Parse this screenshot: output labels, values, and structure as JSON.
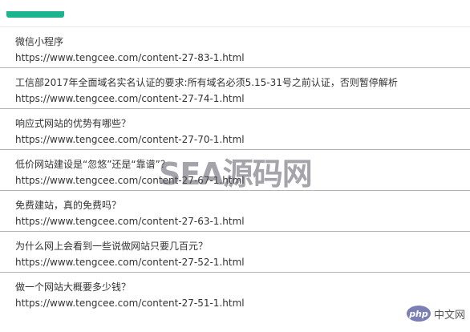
{
  "articles": [
    {
      "title": "微信小程序",
      "url": "https://www.tengcee.com/content-27-83-1.html"
    },
    {
      "title": "工信部2017年全面域名实名认证的要求:所有域名必须5.15-31号之前认证，否则暂停解析",
      "url": "https://www.tengcee.com/content-27-74-1.html"
    },
    {
      "title": "响应式网站的优势有哪些？",
      "url": "https://www.tengcee.com/content-27-70-1.html"
    },
    {
      "title": "低价网站建设是“忽悠”还是“靠谱”？",
      "url": "https://www.tengcee.com/content-27-67-1.html"
    },
    {
      "title": "免费建站，真的免费吗？",
      "url": "https://www.tengcee.com/content-27-63-1.html"
    },
    {
      "title": "为什么网上会看到一些说做网站只要几百元？",
      "url": "https://www.tengcee.com/content-27-52-1.html"
    },
    {
      "title": "做一个网站大概要多少钱？",
      "url": "https://www.tengcee.com/content-27-51-1.html"
    }
  ],
  "watermark": {
    "text": "SEA源码网"
  },
  "badge": {
    "logo": "php",
    "label": "中文网"
  },
  "colors": {
    "accent": "#1cb38f",
    "divider": "#b4b4b4",
    "text": "#333333"
  }
}
